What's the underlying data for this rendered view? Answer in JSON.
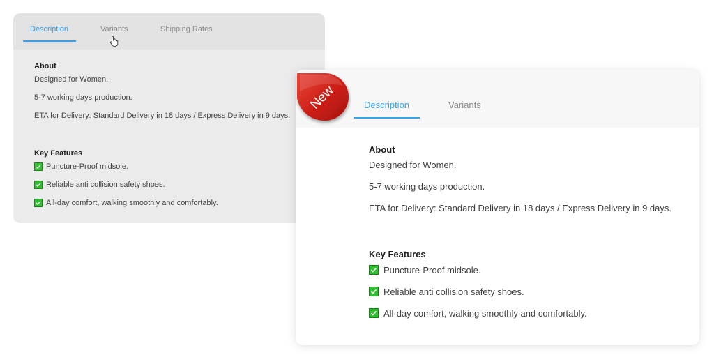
{
  "old_panel": {
    "tabs": [
      {
        "label": "Description",
        "active": true
      },
      {
        "label": "Variants",
        "active": false
      },
      {
        "label": "Shipping Rates",
        "active": false
      }
    ],
    "about": {
      "heading": "About",
      "lines": [
        "Designed for Women.",
        "5-7 working days production.",
        "ETA for Delivery: Standard Delivery in 18 days / Express Delivery in 9 days."
      ]
    },
    "key_features": {
      "heading": "Key Features",
      "items": [
        "Puncture-Proof midsole.",
        "Reliable anti collision safety shoes.",
        "All-day comfort, walking smoothly and comfortably."
      ]
    }
  },
  "new_panel": {
    "badge": {
      "label": "New",
      "color": "#d42a20"
    },
    "tabs": [
      {
        "label": "Description",
        "active": true
      },
      {
        "label": "Variants",
        "active": false
      }
    ],
    "about": {
      "heading": "About",
      "lines": [
        "Designed for Women.",
        "5-7 working days production.",
        "ETA for Delivery: Standard Delivery in 18 days / Express Delivery in 9 days."
      ]
    },
    "key_features": {
      "heading": "Key Features",
      "items": [
        "Puncture-Proof midsole.",
        "Reliable anti collision safety shoes.",
        "All-day comfort, walking smoothly and comfortably."
      ]
    }
  },
  "colors": {
    "accent_blue": "#34a4ee",
    "check_green": "#2fbf2f",
    "badge_red": "#d42a20"
  },
  "icons": {
    "check": "checkbox-checked-icon",
    "cursor": "hand-pointer-icon"
  }
}
